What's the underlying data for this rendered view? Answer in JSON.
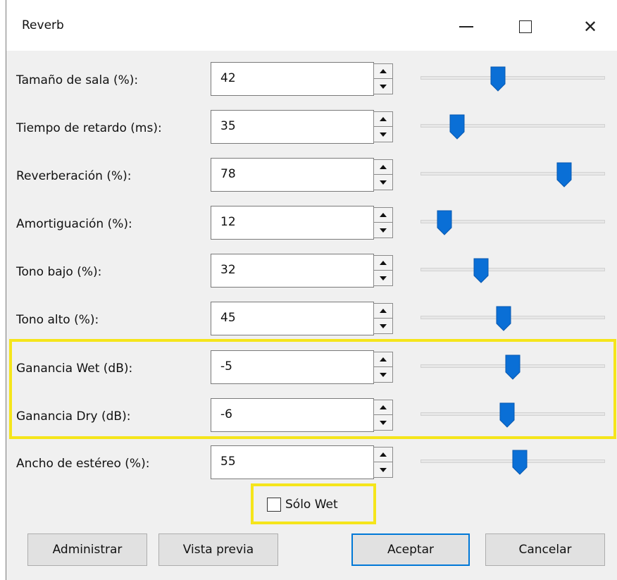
{
  "window": {
    "title": "Reverb",
    "controls": {
      "minimize_icon": "minimize-icon",
      "maximize_icon": "maximize-icon",
      "close_icon": "close-icon"
    }
  },
  "params": [
    {
      "label": "Tamaño de sala (%):",
      "value": "42",
      "slider_fraction": 0.42
    },
    {
      "label": "Tiempo de retardo (ms):",
      "value": "35",
      "slider_fraction": 0.2
    },
    {
      "label": "Reverberación (%):",
      "value": "78",
      "slider_fraction": 0.78
    },
    {
      "label": "Amortiguación (%):",
      "value": "12",
      "slider_fraction": 0.13
    },
    {
      "label": "Tono bajo (%):",
      "value": "32",
      "slider_fraction": 0.33
    },
    {
      "label": "Tono alto (%):",
      "value": "45",
      "slider_fraction": 0.45
    },
    {
      "label": "Ganancia Wet (dB):",
      "value": "-5",
      "slider_fraction": 0.5
    },
    {
      "label": "Ganancia Dry (dB):",
      "value": "-6",
      "slider_fraction": 0.47
    },
    {
      "label": "Ancho de estéreo (%):",
      "value": "55",
      "slider_fraction": 0.54
    }
  ],
  "wet_only": {
    "label": "Sólo Wet",
    "checked": false
  },
  "buttons": {
    "manage": "Administrar",
    "preview": "Vista previa",
    "ok": "Aceptar",
    "cancel": "Cancelar"
  },
  "colors": {
    "accent": "#0078d7",
    "slider_thumb": "#0a6fd6",
    "highlight": "#f5e51b"
  }
}
